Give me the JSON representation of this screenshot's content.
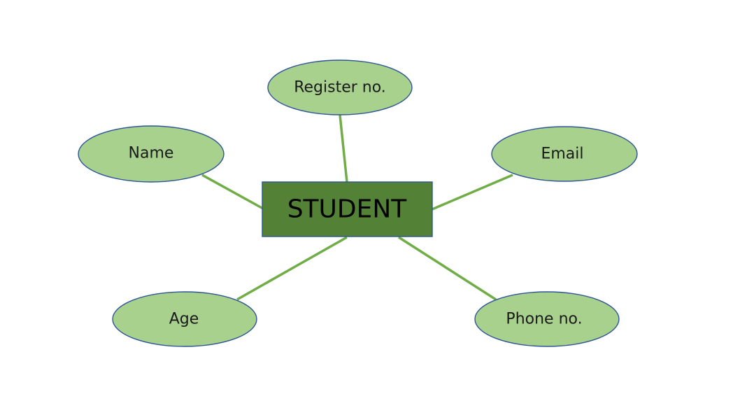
{
  "colors": {
    "entity_fill": "#538135",
    "attribute_fill": "#a9d18e",
    "outline": "#2e5597",
    "connector": "#70ad47"
  },
  "entity": {
    "label": "STUDENT"
  },
  "attributes": {
    "register_no": "Register no.",
    "name": "Name",
    "email": "Email",
    "age": "Age",
    "phone_no": "Phone no."
  }
}
